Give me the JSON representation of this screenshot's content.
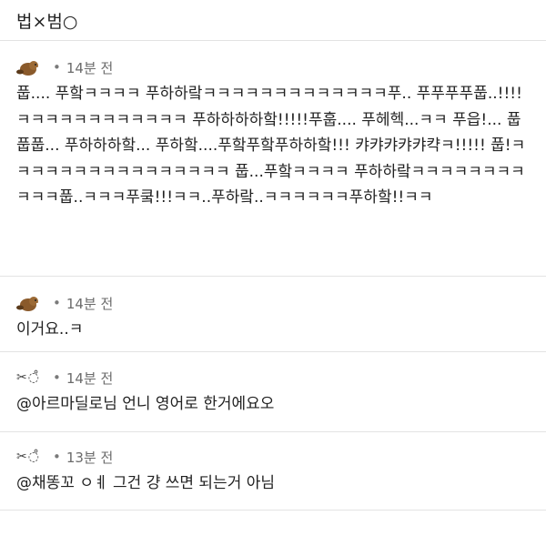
{
  "header": {
    "text": "법×범○"
  },
  "comments": [
    {
      "avatar": "beaver-icon",
      "time": "14분 전",
      "body": "풉.... 푸핰ㅋㅋㅋㅋ 푸하하랔ㅋㅋㅋㅋㅋㅋㅋㅋㅋㅋㅋㅋㅋ푸.. 푸푸푸푸풉..!!!! ㅋㅋㅋㅋㅋㅋㅋㅋㅋㅋㅋㅋ 푸하하하하핰!!!!!푸훕.... 푸헤헥...ㅋㅋ 푸읍!... 풉풉풉... 푸하하하핰... 푸하핰....푸핰푸핰푸하하핰!!! 캬캬캬캬캬캭ㅋ!!!!! 풉!ㅋㅋㅋㅋㅋㅋㅋㅋㅋㅋㅋㅋㅋㅋㅋㅋ 풉...푸핰ㅋㅋㅋㅋ 푸하하랔ㅋㅋㅋㅋㅋㅋㅋㅋㅋㅋㅋ풉..ㅋㅋㅋ푸쿸!!!ㅋㅋ..푸하랔..ㅋㅋㅋㅋㅋㅋ푸하핰!!ㅋㅋ"
    },
    {
      "avatar": "beaver-icon",
      "time": "14분 전",
      "body": "이거요..ㅋ"
    },
    {
      "avatar": "scissors-bubbles-icon",
      "nick": "✂︎◌̊",
      "time": "14분 전",
      "body": "@아르마딜로님 언니 영어로 한거에요오"
    },
    {
      "avatar": "scissors-bubbles-icon",
      "nick": "✂︎◌̊",
      "time": "13분 전",
      "body": "@채똥꼬 ㅇㅖ 그건 걍 쓰면 되는거 아님"
    }
  ],
  "dot": "•"
}
